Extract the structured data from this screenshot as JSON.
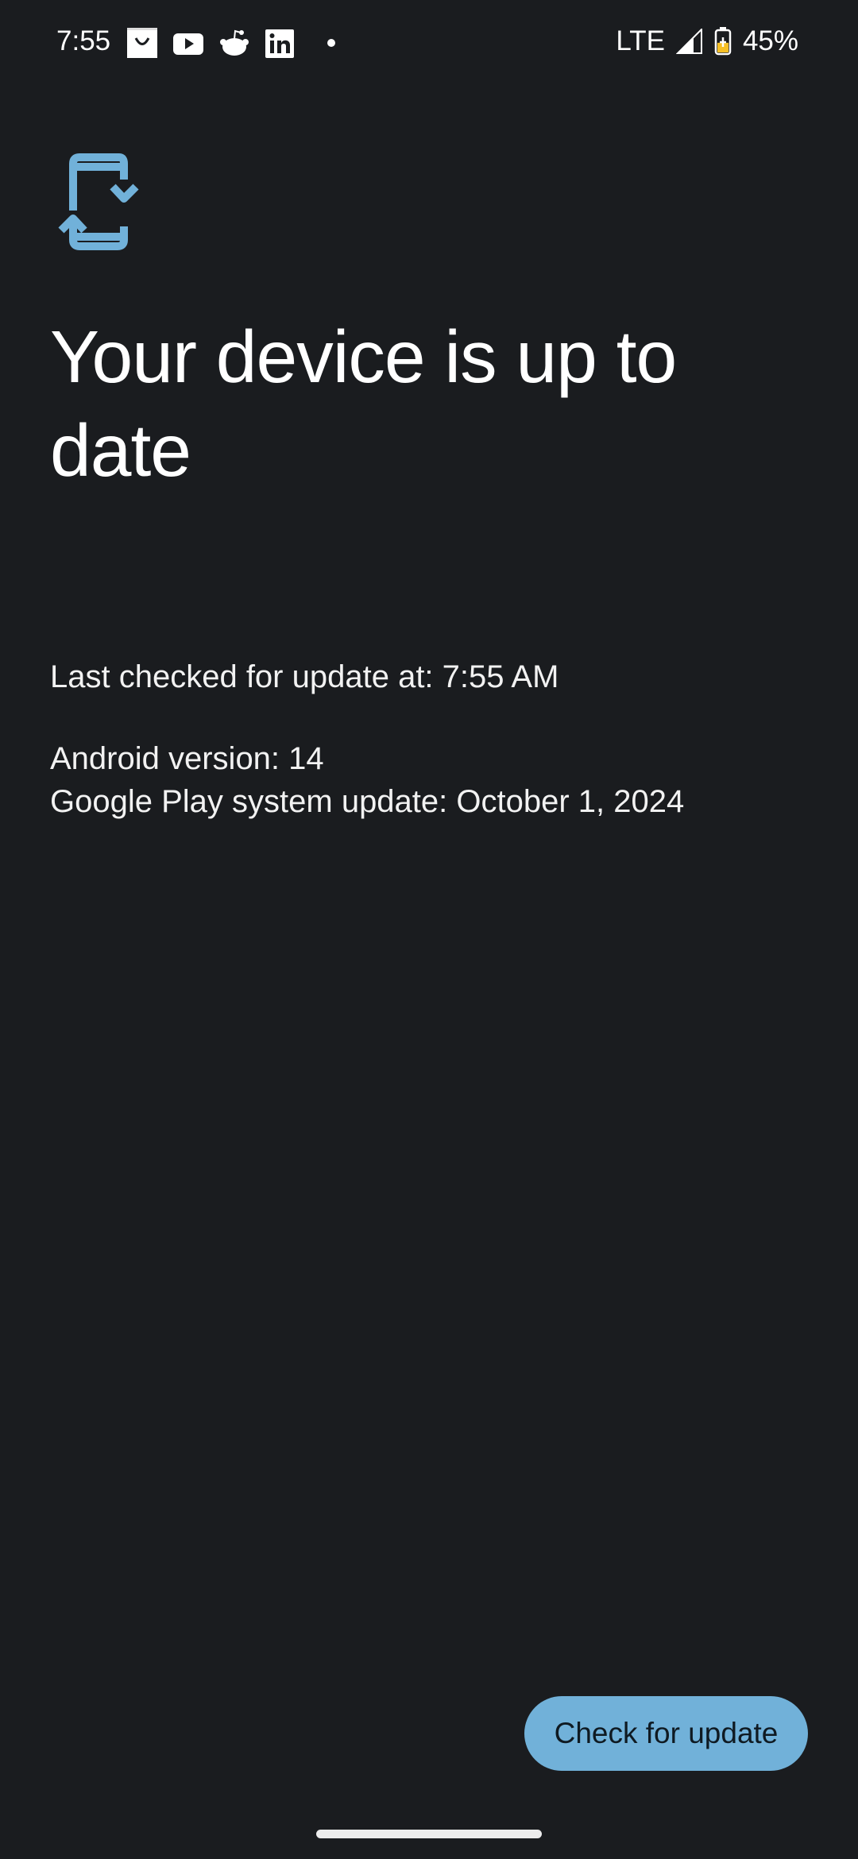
{
  "status_bar": {
    "time": "7:55",
    "notification_icons": [
      "shopping-bag-icon",
      "youtube-icon",
      "reddit-icon",
      "linkedin-icon",
      "more-notifications-dot-icon"
    ],
    "network": "LTE",
    "battery_percent": "45%",
    "battery_level": 0.45,
    "battery_charging": true,
    "battery_color": "#f6c026"
  },
  "main": {
    "icon": "system-update-icon",
    "icon_color": "#71b1d9",
    "title": "Your device is up to date",
    "last_checked": "Last checked for update at: 7:55 AM",
    "android_version": "Android version: 14",
    "google_play_update": "Google Play system update: October 1, 2024"
  },
  "actions": {
    "check_for_update_label": "Check for update",
    "button_color": "#71b1d9"
  }
}
